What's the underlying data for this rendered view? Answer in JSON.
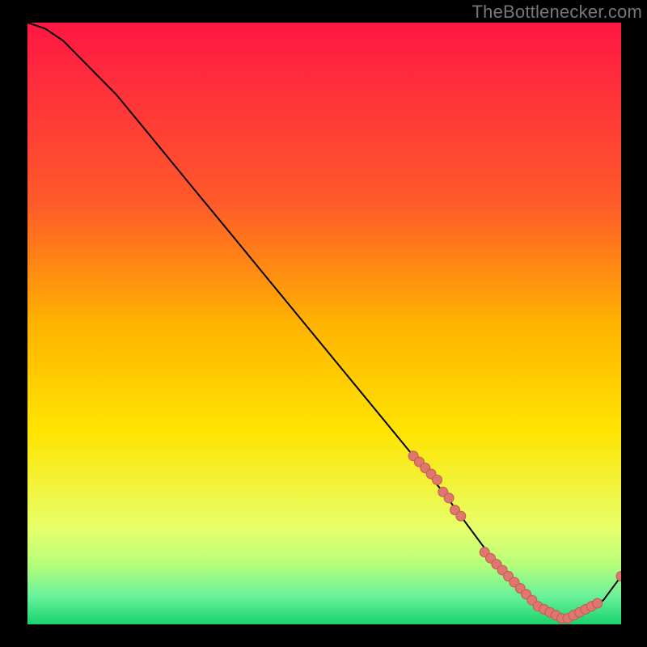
{
  "watermark": "TheBottlenecker.com",
  "colors": {
    "top": "#ff1744",
    "mid_upper": "#ff8a00",
    "mid": "#ffe400",
    "lower": "#c6ff6e",
    "bottom": "#1fe07a",
    "curve": "#000000",
    "point_fill": "#e0776f",
    "point_stroke": "#c05a52"
  },
  "chart_data": {
    "type": "line",
    "title": "",
    "xlabel": "",
    "ylabel": "",
    "xlim": [
      0,
      100
    ],
    "ylim": [
      0,
      100
    ],
    "series": [
      {
        "name": "bottleneck-curve",
        "x": [
          0,
          3,
          6,
          10,
          15,
          20,
          25,
          30,
          35,
          40,
          45,
          50,
          55,
          60,
          65,
          70,
          73,
          76,
          79,
          82,
          85,
          88,
          91,
          94,
          97,
          100
        ],
        "y": [
          100,
          99,
          97,
          93,
          88,
          82,
          76,
          70,
          64,
          58,
          52,
          46,
          40,
          34,
          28,
          22,
          18,
          14,
          10,
          7,
          4,
          2,
          1,
          2,
          4,
          8
        ]
      }
    ],
    "points": {
      "name": "highlighted-range",
      "x": [
        65,
        66,
        67,
        68,
        69,
        70,
        71,
        72,
        73,
        77,
        78,
        79,
        80,
        81,
        82,
        83,
        84,
        85,
        86,
        87,
        88,
        89,
        90,
        91,
        92,
        93,
        94,
        95,
        96,
        100
      ],
      "y": [
        28,
        27,
        26,
        25,
        24,
        22,
        21,
        19,
        18,
        12,
        11,
        10,
        9,
        8,
        7,
        6,
        5,
        4,
        3,
        2.5,
        2,
        1.5,
        1,
        1,
        1.5,
        2,
        2.5,
        3,
        3.5,
        8
      ]
    },
    "gradient_stops": [
      {
        "offset": 0.0,
        "color": "#ff1744"
      },
      {
        "offset": 0.3,
        "color": "#ff5a2a"
      },
      {
        "offset": 0.5,
        "color": "#ffb300"
      },
      {
        "offset": 0.68,
        "color": "#ffe400"
      },
      {
        "offset": 0.84,
        "color": "#e7ff6a"
      },
      {
        "offset": 0.9,
        "color": "#b6ff7a"
      },
      {
        "offset": 0.955,
        "color": "#66f09a"
      },
      {
        "offset": 1.0,
        "color": "#18d46e"
      }
    ]
  }
}
